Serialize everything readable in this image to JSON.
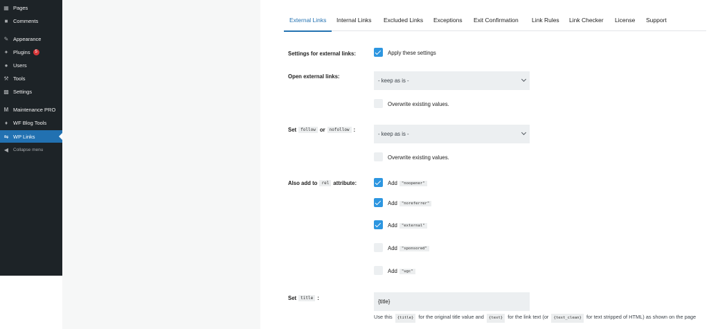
{
  "sidebar": {
    "items": [
      {
        "label": "Pages",
        "icon": "pages-icon"
      },
      {
        "label": "Comments",
        "icon": "comments-icon"
      },
      {
        "label": "Appearance",
        "icon": "appearance-icon"
      },
      {
        "label": "Plugins",
        "icon": "plugins-icon",
        "badge": "5"
      },
      {
        "label": "Users",
        "icon": "users-icon"
      },
      {
        "label": "Tools",
        "icon": "tools-icon"
      },
      {
        "label": "Settings",
        "icon": "settings-icon"
      },
      {
        "label": "Maintenance PRO",
        "icon": "maintenance-icon"
      },
      {
        "label": "WF Blog Tools",
        "icon": "blog-tools-icon"
      },
      {
        "label": "WP Links",
        "icon": "links-icon",
        "active": true
      },
      {
        "label": "Collapse menu",
        "icon": "collapse-icon"
      }
    ]
  },
  "tabs": [
    "External Links",
    "Internal Links",
    "Excluded Links",
    "Exceptions",
    "Exit Confirmation",
    "Link Rules",
    "Link Checker",
    "License",
    "Support"
  ],
  "settings": {
    "external_label": "Settings for external links:",
    "apply_label": "Apply these settings",
    "open_label": "Open external links:",
    "open_value": "- keep as is -",
    "overwrite_label": "Overwrite existing values.",
    "follow_prefix": "Set",
    "follow_code": "follow",
    "follow_or": "or",
    "nofollow_code": "nofollow",
    "follow_suffix": ":",
    "follow_value": "- keep as is -",
    "overwrite_label_2": "Overwrite existing values.",
    "rel_prefix": "Also add to",
    "rel_code": "rel",
    "rel_suffix": "attribute:",
    "add_word": "Add",
    "rel_options": [
      {
        "value": "\"noopener\"",
        "checked": true
      },
      {
        "value": "\"noreferrer\"",
        "checked": true
      },
      {
        "value": "\"external\"",
        "checked": true
      },
      {
        "value": "\"sponsored\"",
        "checked": false
      },
      {
        "value": "\"ugc\"",
        "checked": false
      }
    ],
    "title_prefix": "Set",
    "title_code": "title",
    "title_suffix": ":",
    "title_value": "{title}",
    "help": {
      "t1": "Use this",
      "c1": "{title}",
      "t2": "for the original title value and",
      "c2": "{text}",
      "t3": "for the link text (or",
      "c3": "{text_clean}",
      "t4": "for text stripped of HTML) as shown on the page"
    }
  },
  "colors": {
    "accent": "#2271b1",
    "checkbox": "#2d96e0",
    "sidebar": "#1d2327",
    "badge": "#d63638"
  }
}
